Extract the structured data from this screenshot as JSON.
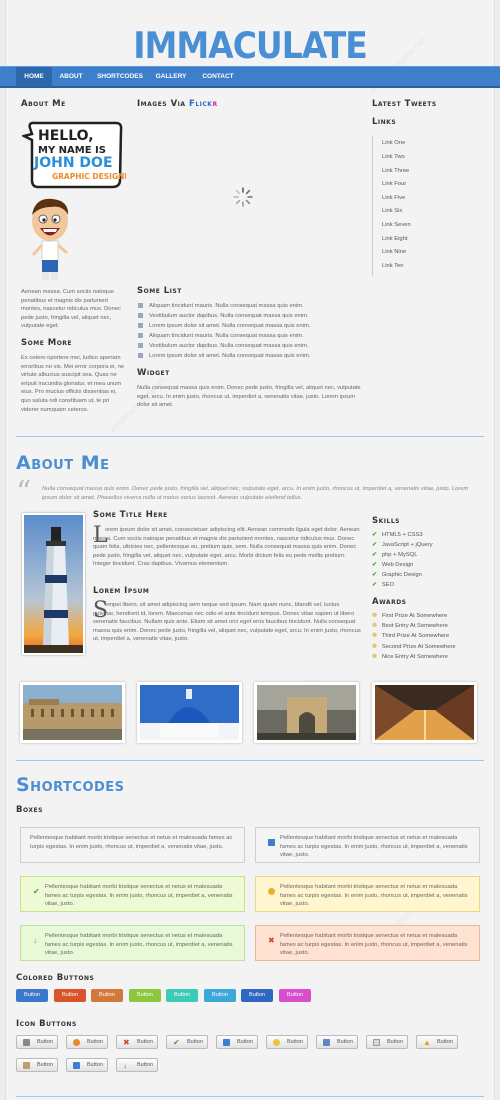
{
  "site": {
    "logo": "IMMACULATE"
  },
  "nav": [
    "HOME",
    "ABOUT",
    "SHORTCODES",
    "GALLERY",
    "CONTACT"
  ],
  "about_me": {
    "heading": "About Me",
    "hello_lines": [
      "HELLO,",
      "MY NAME IS",
      "JOHN DOE",
      "GRAPHIC DESIGNER"
    ],
    "text": "Aenean massa. Cum sociis natoque penatibus et magnis dis parturient montes, nascetur ridiculus mus. Donec pede justo, fringilla vel, aliquet nec, vulputate eget.",
    "more_heading": "Some More",
    "more_text": "Ex cetero oportere mei, ludico aperiam erroribus no vis. Mei error corpora ei, ne virtute albucius suscipit sea. Quas ne eripuit iracundia gloriatur, et mea unum eius. Pro mucius officiis dissentias ei, quo saluta ndi constituam ut, te pri viderer numquam ceteros."
  },
  "flickr": {
    "heading_prefix": "Images Via",
    "heading_brand_1": "Flick",
    "heading_brand_2": "r"
  },
  "some_list": {
    "heading": "Some List",
    "items": [
      "Aliquam tincidunt mauris. Nulla consequat massa quis enim.",
      "Vestibulum auctor dapibus. Nulla consequat massa quis enim.",
      "Lorem ipsum dolor sit amet. Nulla consequat massa quis enim.",
      "Aliquam tincidunt mauris. Nulla consequat massa quis enim.",
      "Vestibulum auctor dapibus. Nulla consequat massa quis enim.",
      "Lorem ipsum dolor sit amet. Nulla consequat massa quis enim."
    ]
  },
  "widget": {
    "heading": "Widget",
    "text": "Nulla consequat massa quis enim. Donec pede justo, fringilla vel, aliquet nec, vulputate eget, arcu. In enim justo, rhoncus ut, imperdiet a, venenatis vitae, justo. Lorem ipsum dolor sit amet."
  },
  "latest_tweets": {
    "heading": "Latest Tweets"
  },
  "links": {
    "heading": "Links",
    "items": [
      "Link One",
      "Link Two",
      "Link Three",
      "Link Four",
      "Link Five",
      "Link Six",
      "Link Seven",
      "Link Eight",
      "Link Nine",
      "Link Ten"
    ]
  },
  "about_section": {
    "heading": "About Me",
    "quote": "Nulla consequat massa quis enim. Donec pede justo, fringilla vel, aliquet nec, vulputate eget, arcu. In enim justo, rhoncus ut, imperdiet a, venenatis vitae, justo. Lorem ipsum dolor sit amet. Phasellus viverra nulla ut metus varius laoreet. Aenean vulputate eleifend tellus.",
    "title1": "Some Title Here",
    "text1_cap": "L",
    "text1": "orem ipsum dolor sit amet, consectetuer adipiscing elit. Aenean commodo ligula eget dolor. Aenean massa. Cum sociis natoque penatibus et magnis dis parturient montes, nascetur ridiculus mus. Donec quam felis, ultricies nec, pellentesque eu, pretium quis, sem. Nulla consequat massa quis enim. Donec pede justo, fringilla vel, aliquet nec, vulputate eget, arcu. Morbi dictum felis eu pede mollis pretium. Integer tincidunt. Cras dapibus. Vivamus elementum.",
    "title2": "Lorem Ipsum",
    "text2_cap": "S",
    "text2": "empei libero, sit amet adipiscing sem neque sed ipsum. Nam quam nunc, blandit vel, luctus pulvinar, hendrerit id, lorem. Maecenas nec odio et ante tincidunt tempus. Donec vitae sapien ut libero venenatis faucibus. Nullam quis ante. Etiam sit amet orci eget eros faucibus tincidunt. Nulla consequat massa quis enim. Donec pede justo, fringilla vel, aliquet nec, vulputate eget, arcu. In enim justo, rhoncus ut, imperdiet a, venenatis vitae, justo.",
    "skills_heading": "Skills",
    "skills": [
      "HTML5 + CSS3",
      "JavaScript + jQuery",
      "php + MySQL",
      "Web Design",
      "Graphic Design",
      "SEO"
    ],
    "awards_heading": "Awards",
    "awards": [
      "First Prize At Somewhere",
      "Best Entry At Somewhere",
      "Third Prize At Somewhere",
      "Second Prize At Somewhere",
      "Nice Entry At Somewhere"
    ]
  },
  "shortcodes": {
    "heading": "Shortcodes",
    "boxes_heading": "Boxes",
    "box_text": "Pellentesque habitant morbi tristique senectus et netus et malesuada fames ac turpis egestas. In enim justo, rhoncus ut, imperdiet a, venenatis vitae, justo.",
    "colored_heading": "Colored Buttons",
    "button_label": "Button",
    "colors": [
      "#3c78cc",
      "#d9542b",
      "#d2783c",
      "#8bc93c",
      "#3ccbb5",
      "#3ca8d8",
      "#2f68c0",
      "#d84ecb"
    ],
    "icon_heading": "Icon Buttons",
    "icon_buttons": [
      "wrench-icon",
      "palette-icon",
      "cross-icon",
      "check-icon",
      "info-icon",
      "smiley-icon",
      "upload-icon",
      "mail-icon",
      "warning-icon",
      "pencil-icon",
      "download-icon",
      "arrow-icon"
    ]
  }
}
